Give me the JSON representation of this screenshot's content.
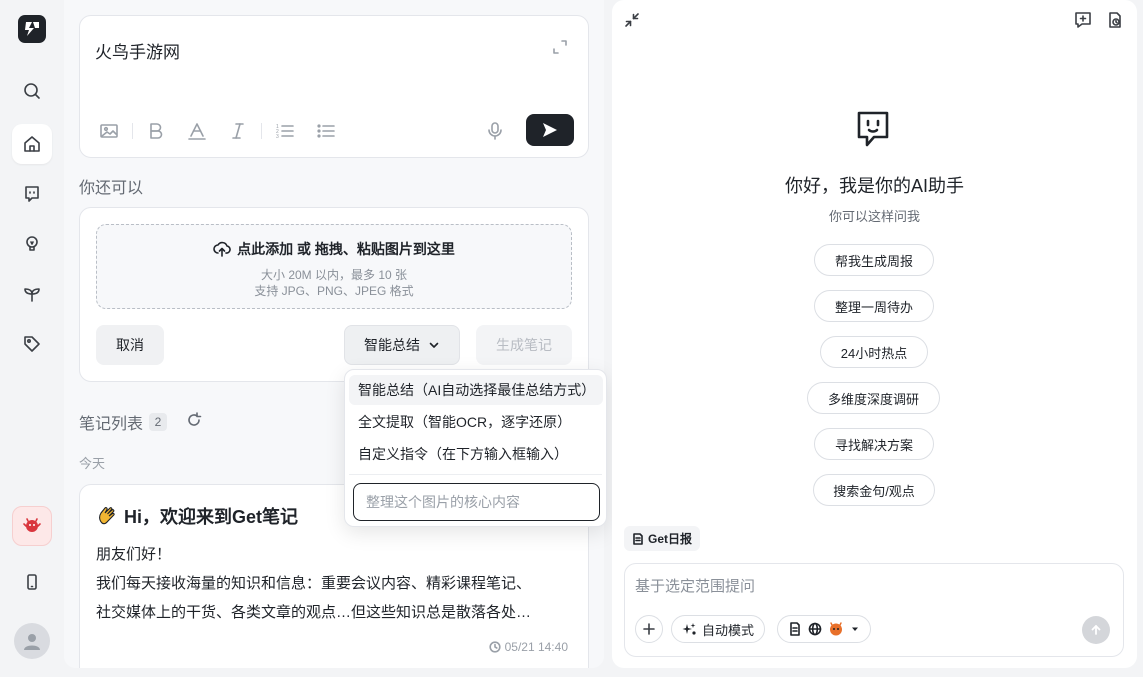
{
  "rail": {
    "items": [
      {
        "icon": "search-icon"
      },
      {
        "icon": "home-icon",
        "active": true
      },
      {
        "icon": "chat-icon"
      },
      {
        "icon": "bulb-icon"
      },
      {
        "icon": "sprout-icon"
      },
      {
        "icon": "tag-icon"
      },
      {
        "icon": "mobile-icon"
      }
    ]
  },
  "editor": {
    "text": "火鸟手游网"
  },
  "also": {
    "label": "你还可以"
  },
  "upload": {
    "title": "点此添加 或 拖拽、粘贴图片到这里",
    "limit": "大小 20M 以内，最多 10 张",
    "formats": "支持 JPG、PNG、JPEG 格式",
    "cancel_label": "取消",
    "summary_label": "智能总结",
    "generate_label": "生成笔记"
  },
  "menu": {
    "items": [
      {
        "label": "智能总结（AI自动选择最佳总结方式）",
        "selected": true
      },
      {
        "label": "全文提取（智能OCR，逐字还原）"
      },
      {
        "label": "自定义指令（在下方输入框输入）"
      }
    ],
    "custom_placeholder": "整理这个图片的核心内容"
  },
  "notes": {
    "title": "笔记列表",
    "count": "2",
    "group_label": "今天",
    "card": {
      "title": "Hi，欢迎来到Get笔记",
      "line1": "朋友们好！",
      "line2": "我们每天接收海量的知识和信息：重要会议内容、精彩课程笔记、",
      "line3": "社交媒体上的干货、各类文章的观点…但这些知识总是散落各处…",
      "time": "05/21 14:40"
    }
  },
  "assistant": {
    "greeting": "你好，我是你的AI助手",
    "subtitle": "你可以这样问我",
    "suggestions": [
      "帮我生成周报",
      "整理一周待办",
      "24小时热点",
      "多维度深度调研",
      "寻找解决方案",
      "搜索金句/观点"
    ],
    "daily_label": "Get日报",
    "ask_placeholder": "基于选定范围提问",
    "mode_label": "自动模式"
  },
  "colors": {
    "dark": "#1f2329",
    "muted": "#646a73",
    "border": "#e4e6eb"
  }
}
